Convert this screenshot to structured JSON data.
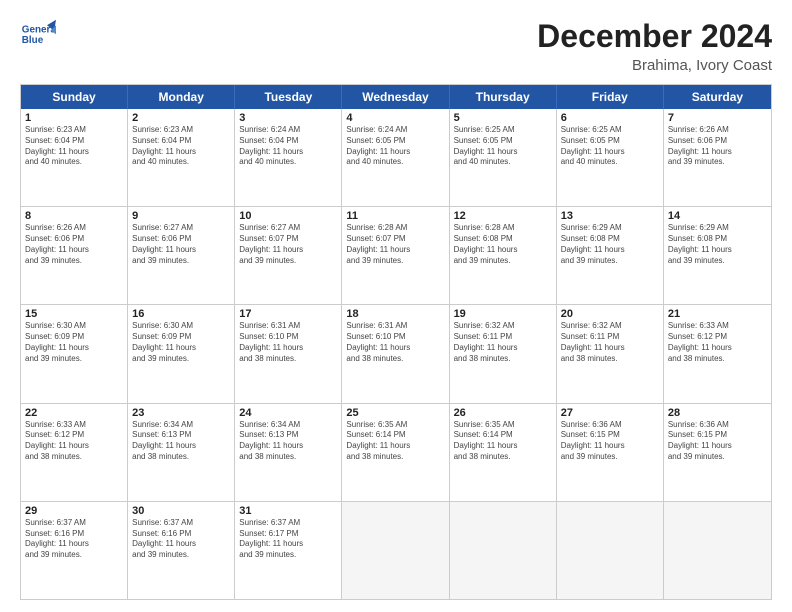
{
  "header": {
    "logo_line1": "General",
    "logo_line2": "Blue",
    "main_title": "December 2024",
    "subtitle": "Brahima, Ivory Coast"
  },
  "calendar": {
    "days_of_week": [
      "Sunday",
      "Monday",
      "Tuesday",
      "Wednesday",
      "Thursday",
      "Friday",
      "Saturday"
    ],
    "rows": [
      [
        {
          "day": "1",
          "lines": [
            "Sunrise: 6:23 AM",
            "Sunset: 6:04 PM",
            "Daylight: 11 hours",
            "and 40 minutes."
          ]
        },
        {
          "day": "2",
          "lines": [
            "Sunrise: 6:23 AM",
            "Sunset: 6:04 PM",
            "Daylight: 11 hours",
            "and 40 minutes."
          ]
        },
        {
          "day": "3",
          "lines": [
            "Sunrise: 6:24 AM",
            "Sunset: 6:04 PM",
            "Daylight: 11 hours",
            "and 40 minutes."
          ]
        },
        {
          "day": "4",
          "lines": [
            "Sunrise: 6:24 AM",
            "Sunset: 6:05 PM",
            "Daylight: 11 hours",
            "and 40 minutes."
          ]
        },
        {
          "day": "5",
          "lines": [
            "Sunrise: 6:25 AM",
            "Sunset: 6:05 PM",
            "Daylight: 11 hours",
            "and 40 minutes."
          ]
        },
        {
          "day": "6",
          "lines": [
            "Sunrise: 6:25 AM",
            "Sunset: 6:05 PM",
            "Daylight: 11 hours",
            "and 40 minutes."
          ]
        },
        {
          "day": "7",
          "lines": [
            "Sunrise: 6:26 AM",
            "Sunset: 6:06 PM",
            "Daylight: 11 hours",
            "and 39 minutes."
          ]
        }
      ],
      [
        {
          "day": "8",
          "lines": [
            "Sunrise: 6:26 AM",
            "Sunset: 6:06 PM",
            "Daylight: 11 hours",
            "and 39 minutes."
          ]
        },
        {
          "day": "9",
          "lines": [
            "Sunrise: 6:27 AM",
            "Sunset: 6:06 PM",
            "Daylight: 11 hours",
            "and 39 minutes."
          ]
        },
        {
          "day": "10",
          "lines": [
            "Sunrise: 6:27 AM",
            "Sunset: 6:07 PM",
            "Daylight: 11 hours",
            "and 39 minutes."
          ]
        },
        {
          "day": "11",
          "lines": [
            "Sunrise: 6:28 AM",
            "Sunset: 6:07 PM",
            "Daylight: 11 hours",
            "and 39 minutes."
          ]
        },
        {
          "day": "12",
          "lines": [
            "Sunrise: 6:28 AM",
            "Sunset: 6:08 PM",
            "Daylight: 11 hours",
            "and 39 minutes."
          ]
        },
        {
          "day": "13",
          "lines": [
            "Sunrise: 6:29 AM",
            "Sunset: 6:08 PM",
            "Daylight: 11 hours",
            "and 39 minutes."
          ]
        },
        {
          "day": "14",
          "lines": [
            "Sunrise: 6:29 AM",
            "Sunset: 6:08 PM",
            "Daylight: 11 hours",
            "and 39 minutes."
          ]
        }
      ],
      [
        {
          "day": "15",
          "lines": [
            "Sunrise: 6:30 AM",
            "Sunset: 6:09 PM",
            "Daylight: 11 hours",
            "and 39 minutes."
          ]
        },
        {
          "day": "16",
          "lines": [
            "Sunrise: 6:30 AM",
            "Sunset: 6:09 PM",
            "Daylight: 11 hours",
            "and 39 minutes."
          ]
        },
        {
          "day": "17",
          "lines": [
            "Sunrise: 6:31 AM",
            "Sunset: 6:10 PM",
            "Daylight: 11 hours",
            "and 38 minutes."
          ]
        },
        {
          "day": "18",
          "lines": [
            "Sunrise: 6:31 AM",
            "Sunset: 6:10 PM",
            "Daylight: 11 hours",
            "and 38 minutes."
          ]
        },
        {
          "day": "19",
          "lines": [
            "Sunrise: 6:32 AM",
            "Sunset: 6:11 PM",
            "Daylight: 11 hours",
            "and 38 minutes."
          ]
        },
        {
          "day": "20",
          "lines": [
            "Sunrise: 6:32 AM",
            "Sunset: 6:11 PM",
            "Daylight: 11 hours",
            "and 38 minutes."
          ]
        },
        {
          "day": "21",
          "lines": [
            "Sunrise: 6:33 AM",
            "Sunset: 6:12 PM",
            "Daylight: 11 hours",
            "and 38 minutes."
          ]
        }
      ],
      [
        {
          "day": "22",
          "lines": [
            "Sunrise: 6:33 AM",
            "Sunset: 6:12 PM",
            "Daylight: 11 hours",
            "and 38 minutes."
          ]
        },
        {
          "day": "23",
          "lines": [
            "Sunrise: 6:34 AM",
            "Sunset: 6:13 PM",
            "Daylight: 11 hours",
            "and 38 minutes."
          ]
        },
        {
          "day": "24",
          "lines": [
            "Sunrise: 6:34 AM",
            "Sunset: 6:13 PM",
            "Daylight: 11 hours",
            "and 38 minutes."
          ]
        },
        {
          "day": "25",
          "lines": [
            "Sunrise: 6:35 AM",
            "Sunset: 6:14 PM",
            "Daylight: 11 hours",
            "and 38 minutes."
          ]
        },
        {
          "day": "26",
          "lines": [
            "Sunrise: 6:35 AM",
            "Sunset: 6:14 PM",
            "Daylight: 11 hours",
            "and 38 minutes."
          ]
        },
        {
          "day": "27",
          "lines": [
            "Sunrise: 6:36 AM",
            "Sunset: 6:15 PM",
            "Daylight: 11 hours",
            "and 39 minutes."
          ]
        },
        {
          "day": "28",
          "lines": [
            "Sunrise: 6:36 AM",
            "Sunset: 6:15 PM",
            "Daylight: 11 hours",
            "and 39 minutes."
          ]
        }
      ],
      [
        {
          "day": "29",
          "lines": [
            "Sunrise: 6:37 AM",
            "Sunset: 6:16 PM",
            "Daylight: 11 hours",
            "and 39 minutes."
          ]
        },
        {
          "day": "30",
          "lines": [
            "Sunrise: 6:37 AM",
            "Sunset: 6:16 PM",
            "Daylight: 11 hours",
            "and 39 minutes."
          ]
        },
        {
          "day": "31",
          "lines": [
            "Sunrise: 6:37 AM",
            "Sunset: 6:17 PM",
            "Daylight: 11 hours",
            "and 39 minutes."
          ]
        },
        {
          "day": "",
          "lines": []
        },
        {
          "day": "",
          "lines": []
        },
        {
          "day": "",
          "lines": []
        },
        {
          "day": "",
          "lines": []
        }
      ]
    ]
  }
}
